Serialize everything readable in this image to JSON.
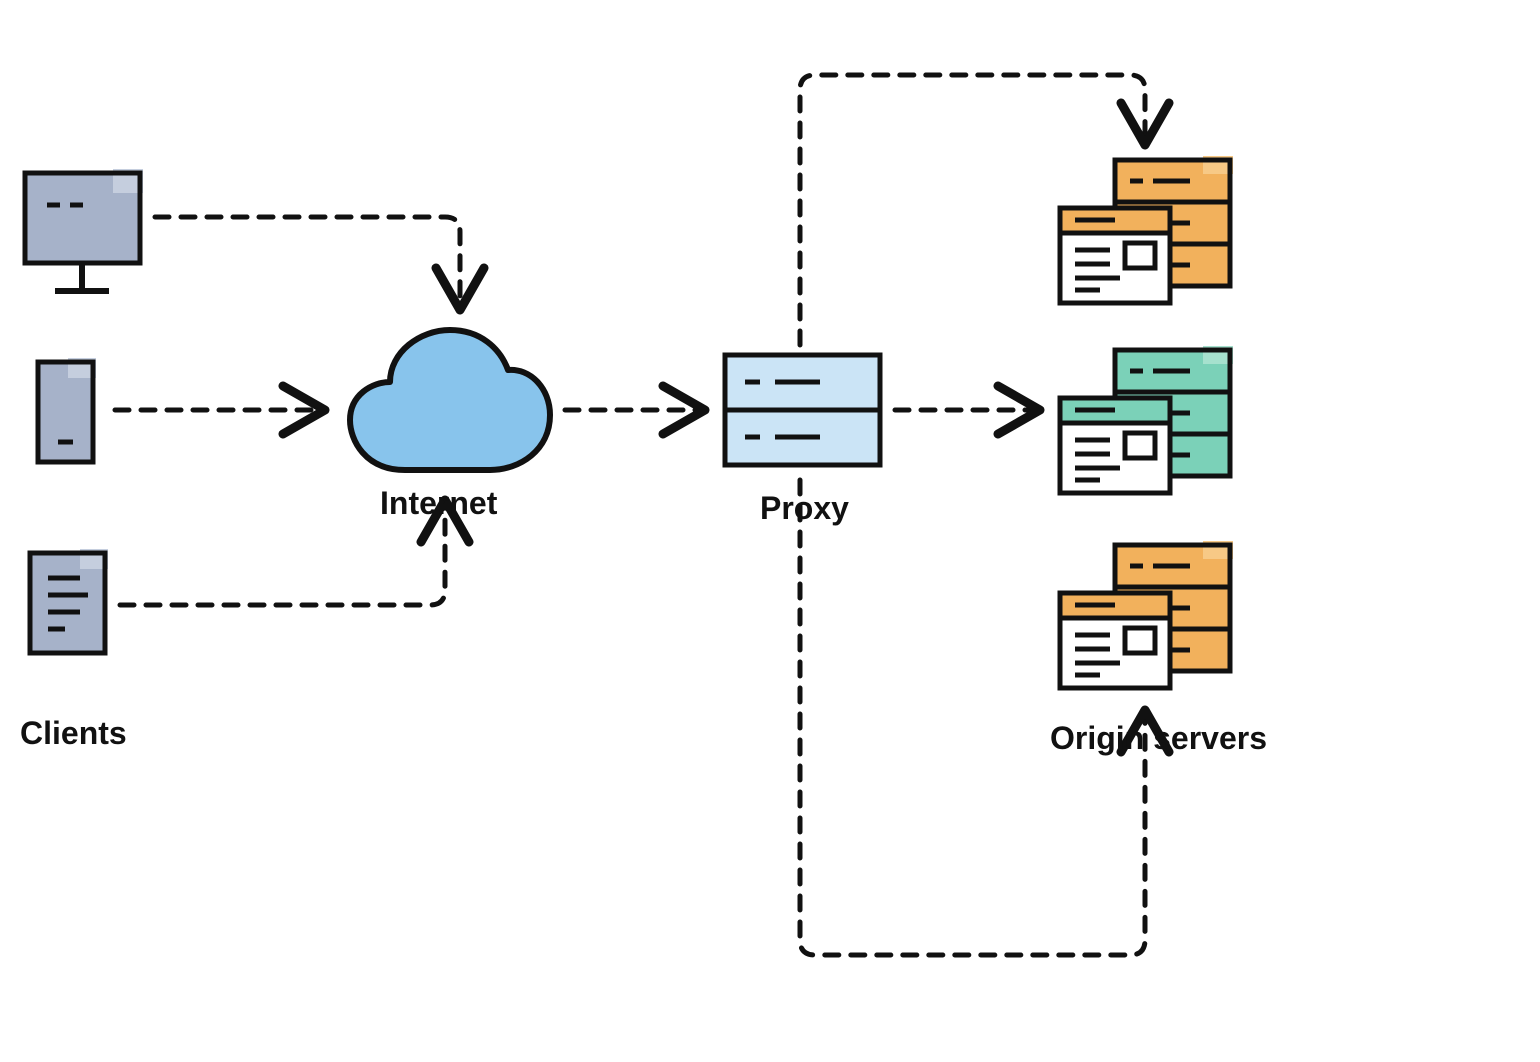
{
  "labels": {
    "clients": "Clients",
    "internet": "Internet",
    "proxy": "Proxy",
    "origin_servers": "Origin servers"
  },
  "colors": {
    "client_fill": "#A6B2C9",
    "client_accent": "#C5CEDE",
    "cloud_fill": "#88C4EC",
    "proxy_fill": "#CBE4F6",
    "server_orange": "#F2B15C",
    "server_green": "#7BD1B8",
    "browser_fill": "#FFFFFF",
    "stroke": "#111111"
  },
  "nodes": [
    {
      "id": "client_monitor",
      "type": "monitor"
    },
    {
      "id": "client_phone",
      "type": "phone"
    },
    {
      "id": "client_doc",
      "type": "document"
    },
    {
      "id": "internet",
      "type": "cloud"
    },
    {
      "id": "proxy",
      "type": "server-stack"
    },
    {
      "id": "origin_1",
      "type": "server-with-browser",
      "color": "orange"
    },
    {
      "id": "origin_2",
      "type": "server-with-browser",
      "color": "green"
    },
    {
      "id": "origin_3",
      "type": "server-with-browser",
      "color": "orange"
    }
  ],
  "edges": [
    {
      "from": "client_monitor",
      "to": "internet",
      "style": "dashed"
    },
    {
      "from": "client_phone",
      "to": "internet",
      "style": "dashed"
    },
    {
      "from": "client_doc",
      "to": "internet",
      "style": "dashed"
    },
    {
      "from": "internet",
      "to": "proxy",
      "style": "dashed"
    },
    {
      "from": "proxy",
      "to": "origin_1",
      "style": "dashed"
    },
    {
      "from": "proxy",
      "to": "origin_2",
      "style": "dashed"
    },
    {
      "from": "proxy",
      "to": "origin_3",
      "style": "dashed"
    }
  ]
}
